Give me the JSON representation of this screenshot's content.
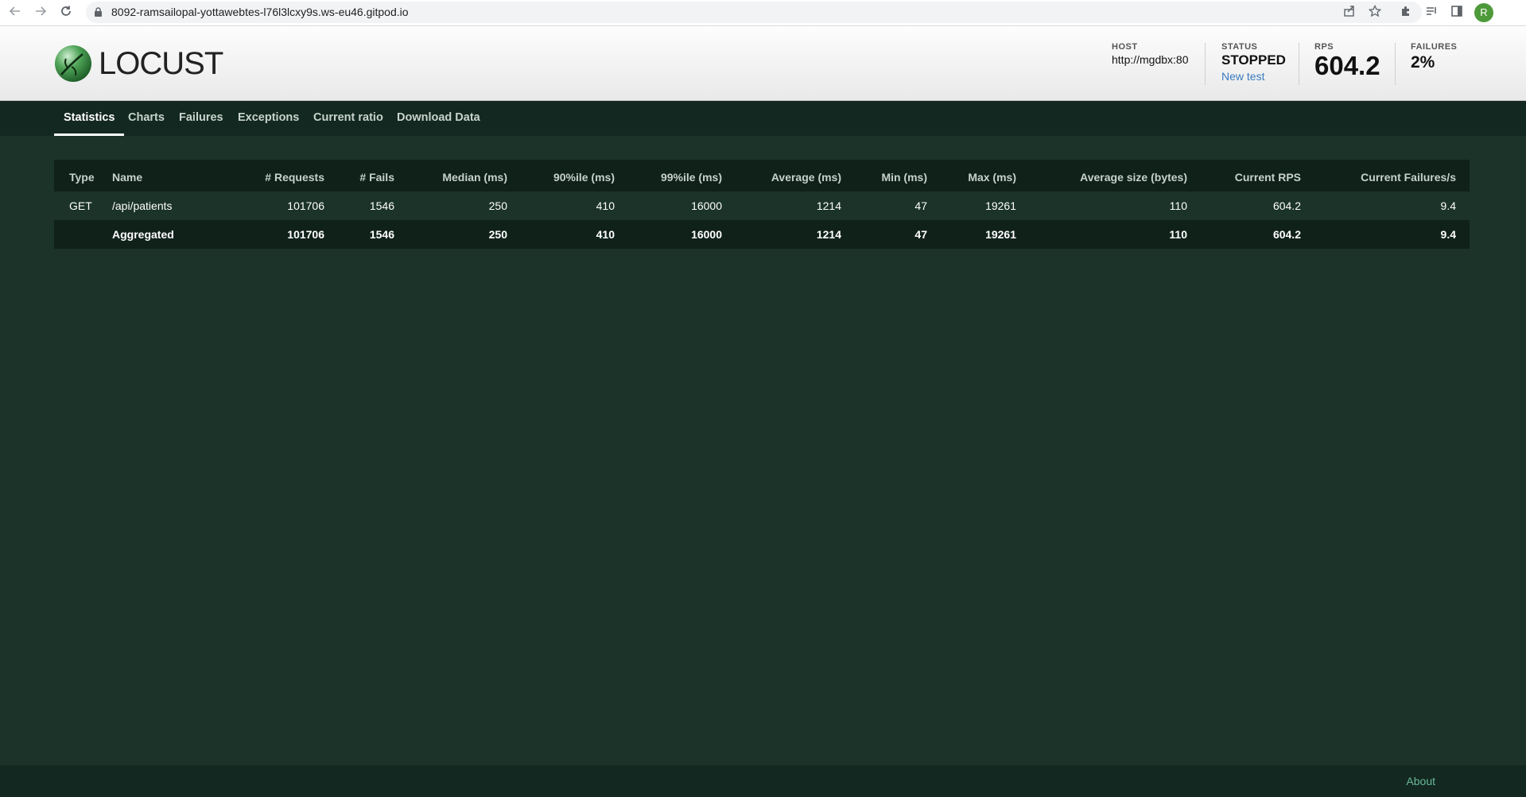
{
  "browser": {
    "url": "8092-ramsailopal-yottawebtes-l76l3lcxy9s.ws-eu46.gitpod.io",
    "profile_initial": "R"
  },
  "app": {
    "logo_text": "LOCUST"
  },
  "header": {
    "host_label": "HOST",
    "host_value": "http://mgdbx:80",
    "status_label": "STATUS",
    "status_value": "STOPPED",
    "new_test_label": "New test",
    "rps_label": "RPS",
    "rps_value": "604.2",
    "failures_label": "FAILURES",
    "failures_value": "2%"
  },
  "tabs": [
    {
      "label": "Statistics"
    },
    {
      "label": "Charts"
    },
    {
      "label": "Failures"
    },
    {
      "label": "Exceptions"
    },
    {
      "label": "Current ratio"
    },
    {
      "label": "Download Data"
    }
  ],
  "table": {
    "columns": [
      "Type",
      "Name",
      "# Requests",
      "# Fails",
      "Median (ms)",
      "90%ile (ms)",
      "99%ile (ms)",
      "Average (ms)",
      "Min (ms)",
      "Max (ms)",
      "Average size (bytes)",
      "Current RPS",
      "Current Failures/s"
    ],
    "rows": [
      [
        "GET",
        "/api/patients",
        "101706",
        "1546",
        "250",
        "410",
        "16000",
        "1214",
        "47",
        "19261",
        "110",
        "604.2",
        "9.4"
      ]
    ],
    "aggregated": [
      "",
      "Aggregated",
      "101706",
      "1546",
      "250",
      "410",
      "16000",
      "1214",
      "47",
      "19261",
      "110",
      "604.2",
      "9.4"
    ]
  },
  "footer": {
    "about_label": "About"
  },
  "colors": {
    "page_bg": "#1b3329",
    "nav_bg": "#132820",
    "link_blue": "#3a7bbf",
    "about_green": "#68b89a"
  },
  "icons": [
    "back-arrow-icon",
    "forward-arrow-icon",
    "reload-icon",
    "lock-icon",
    "share-icon",
    "star-icon",
    "puzzle-icon",
    "reading-list-icon",
    "side-panel-icon",
    "locust-logo-icon"
  ]
}
